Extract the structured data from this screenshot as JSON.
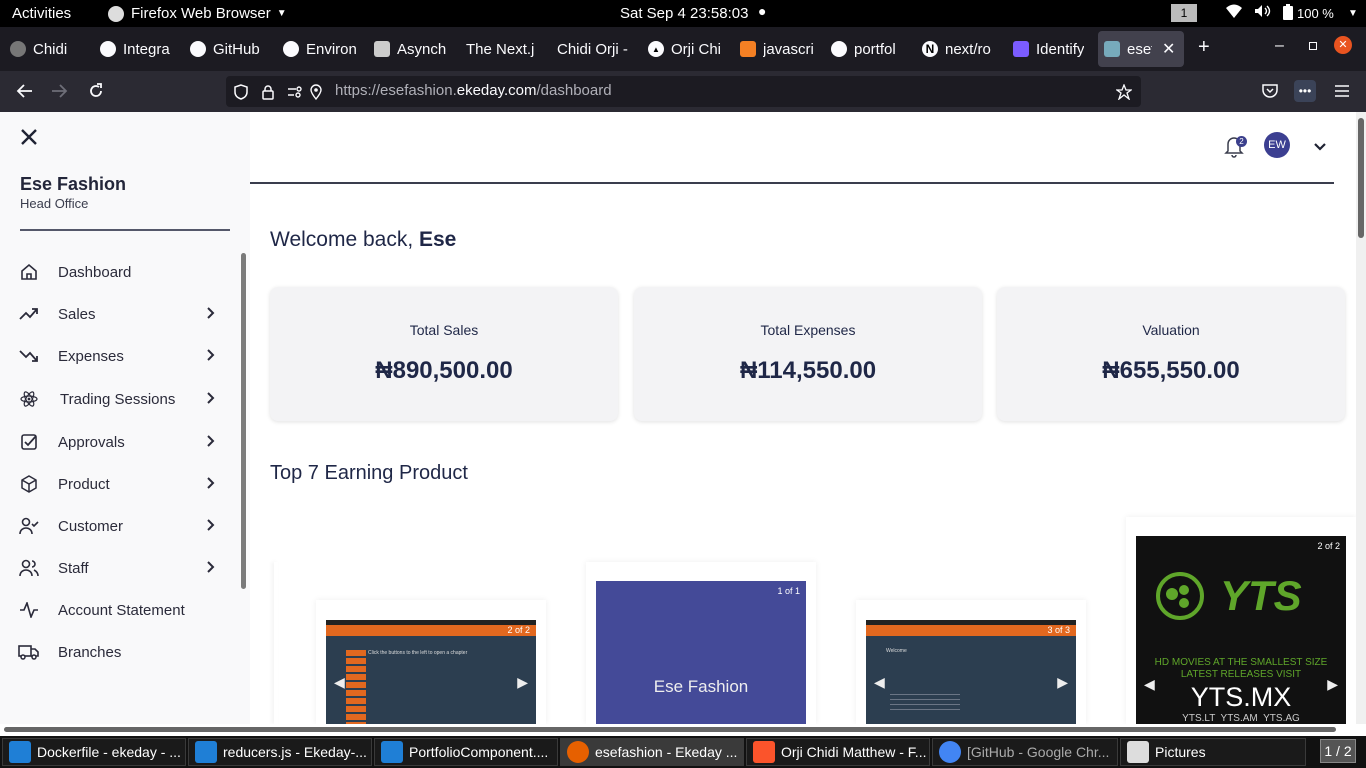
{
  "topbar": {
    "activities": "Activities",
    "app": "Firefox Web Browser",
    "clock": "Sat Sep 4  23:58:03",
    "workspace": "1",
    "battery": "100 %"
  },
  "tabs": [
    {
      "label": "Chidi",
      "icon": "avatar-icon"
    },
    {
      "label": "Integra",
      "icon": "github-icon"
    },
    {
      "label": "GitHub",
      "icon": "github-icon"
    },
    {
      "label": "Environ",
      "icon": "github-icon"
    },
    {
      "label": "Asynch",
      "icon": "page-icon"
    },
    {
      "label": "The Next.j",
      "icon": "none"
    },
    {
      "label": "Chidi Orji -",
      "icon": "none"
    },
    {
      "label": "Orji Chi",
      "icon": "triangle-icon"
    },
    {
      "label": "javascri",
      "icon": "stackoverflow-icon"
    },
    {
      "label": "portfol",
      "icon": "github-icon"
    },
    {
      "label": "next/ro",
      "icon": "nextjs-icon"
    },
    {
      "label": "Identify",
      "icon": "figure-icon"
    },
    {
      "label": "esefa",
      "icon": "vercel-icon"
    }
  ],
  "address": {
    "prefix": "https://esefashion.",
    "domain": "ekeday.com",
    "path": "/dashboard"
  },
  "sidebar": {
    "business": "Ese Fashion",
    "branch": "Head Office",
    "items": [
      {
        "label": "Dashboard"
      },
      {
        "label": "Sales"
      },
      {
        "label": "Expenses"
      },
      {
        "label": "Trading Sessions"
      },
      {
        "label": "Approvals"
      },
      {
        "label": "Product"
      },
      {
        "label": "Customer"
      },
      {
        "label": "Staff"
      },
      {
        "label": "Account Statement"
      },
      {
        "label": "Branches"
      }
    ]
  },
  "header": {
    "avatar": "EW",
    "notifications": "2"
  },
  "welcome": {
    "greeting": "Welcome back, ",
    "name": "Ese"
  },
  "stats": [
    {
      "label": "Total Sales",
      "value": "₦890,500.00"
    },
    {
      "label": "Total Expenses",
      "value": "₦114,550.00"
    },
    {
      "label": "Valuation",
      "value": "₦655,550.00"
    }
  ],
  "section_title": "Top 7 Earning Product",
  "products": [
    {
      "page": "2 of 2",
      "caption": "Click the buttons to the left to open a chapter"
    },
    {
      "page": "1 of 1",
      "caption": "Ese Fashion"
    },
    {
      "page": "3 of 3",
      "caption": "Welcome"
    },
    {
      "page": "2 of 2",
      "caption": "YTS",
      "tagline1": "HD MOVIES AT THE SMALLEST SIZE",
      "tagline2": "LATEST RELEASES VISIT",
      "site": "YTS.MX",
      "mirrors": "YTS.LT  YTS.AM  YTS.AG"
    }
  ],
  "taskbar": [
    {
      "label": "Dockerfile - ekeday - ...",
      "icon": "vscode-icon"
    },
    {
      "label": "reducers.js - Ekeday-...",
      "icon": "vscode-icon"
    },
    {
      "label": "PortfolioComponent....",
      "icon": "vscode-icon"
    },
    {
      "label": "esefashion - Ekeday ...",
      "icon": "firefox-icon"
    },
    {
      "label": "Orji Chidi Matthew - F...",
      "icon": "brave-icon"
    },
    {
      "label": "[GitHub - Google Chr...",
      "icon": "chrome-icon"
    },
    {
      "label": "Pictures",
      "icon": "folder-icon"
    }
  ],
  "pager": "1 / 2"
}
